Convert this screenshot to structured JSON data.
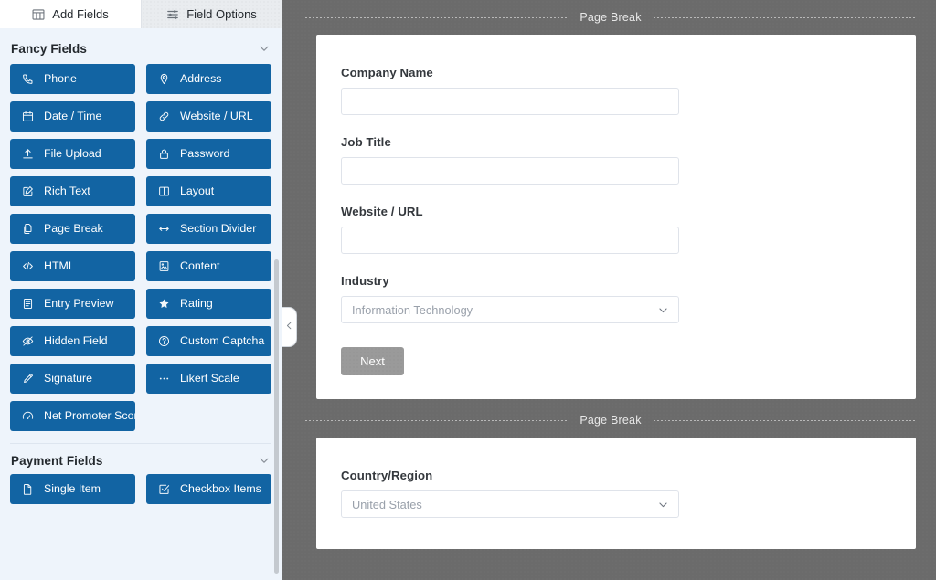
{
  "tabs": [
    {
      "label": "Add Fields",
      "icon": "table-fields-icon",
      "active": true
    },
    {
      "label": "Field Options",
      "icon": "sliders-icon",
      "active": false
    }
  ],
  "sidebar": {
    "groups": [
      {
        "title": "Fancy Fields",
        "chevron": "chevron-down-icon",
        "fields": [
          {
            "label": "Phone",
            "icon": "phone-icon"
          },
          {
            "label": "Address",
            "icon": "map-pin-icon"
          },
          {
            "label": "Date / Time",
            "icon": "calendar-icon"
          },
          {
            "label": "Website / URL",
            "icon": "link-icon"
          },
          {
            "label": "File Upload",
            "icon": "upload-icon"
          },
          {
            "label": "Password",
            "icon": "lock-icon"
          },
          {
            "label": "Rich Text",
            "icon": "pencil-square-icon"
          },
          {
            "label": "Layout",
            "icon": "columns-icon"
          },
          {
            "label": "Page Break",
            "icon": "pages-icon"
          },
          {
            "label": "Section Divider",
            "icon": "arrows-horizontal-icon"
          },
          {
            "label": "HTML",
            "icon": "code-icon"
          },
          {
            "label": "Content",
            "icon": "image-doc-icon"
          },
          {
            "label": "Entry Preview",
            "icon": "document-lines-icon"
          },
          {
            "label": "Rating",
            "icon": "star-icon"
          },
          {
            "label": "Hidden Field",
            "icon": "eye-slash-icon"
          },
          {
            "label": "Custom Captcha",
            "icon": "question-circle-icon"
          },
          {
            "label": "Signature",
            "icon": "pen-icon"
          },
          {
            "label": "Likert Scale",
            "icon": "dots-icon"
          },
          {
            "label": "Net Promoter Score",
            "icon": "gauge-icon"
          }
        ]
      },
      {
        "title": "Payment Fields",
        "chevron": "chevron-down-icon",
        "fields": [
          {
            "label": "Single Item",
            "icon": "file-icon"
          },
          {
            "label": "Checkbox Items",
            "icon": "checkbox-icon"
          }
        ]
      }
    ],
    "collapse_handle": "chevron-left-icon"
  },
  "canvas": {
    "page_break_top": {
      "label": "Page Break"
    },
    "page_break_bottom": {
      "label": "Page Break"
    },
    "page_one": {
      "fields": [
        {
          "label": "Company Name",
          "type": "text",
          "value": "",
          "placeholder": ""
        },
        {
          "label": "Job Title",
          "type": "text",
          "value": "",
          "placeholder": ""
        },
        {
          "label": "Website / URL",
          "type": "text",
          "value": "",
          "placeholder": ""
        },
        {
          "label": "Industry",
          "type": "select",
          "value": "Information Technology"
        }
      ],
      "next_label": "Next"
    },
    "page_two": {
      "fields": [
        {
          "label": "Country/Region",
          "type": "select",
          "value": "United States"
        }
      ]
    }
  },
  "colors": {
    "field_button": "#1264a3",
    "panel_background": "#eef4fb",
    "canvas_background": "#6b6b6b",
    "next_button": "#9a9a9a"
  }
}
